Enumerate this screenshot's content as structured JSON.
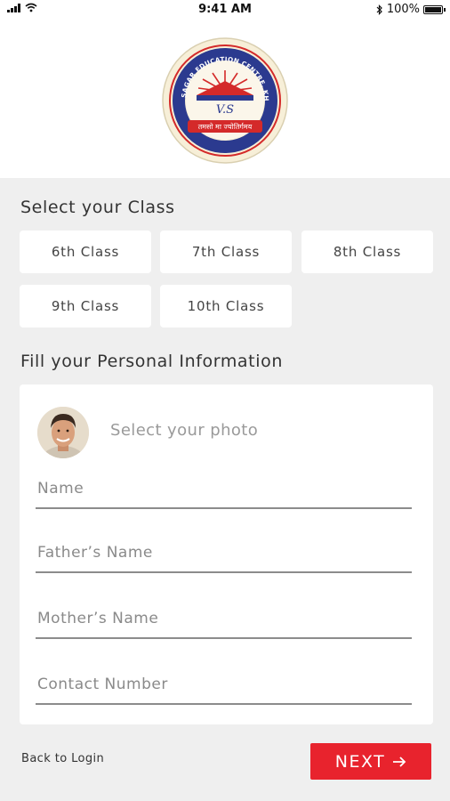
{
  "status_bar": {
    "time": "9:41 AM",
    "battery": "100%",
    "battery_level": 1.0
  },
  "logo": {
    "ring_text": "VIDYA SAGAR EDUCATION CENTRE, KHANDA",
    "monogram": "V.S",
    "motto": "तमसो मा ज्योतिर्गमय",
    "colors": {
      "ring": "#2b3a8f",
      "red": "#d42a2a",
      "cream": "#f7efd8"
    }
  },
  "class_section": {
    "title": "Select your Class",
    "options": [
      "6th Class",
      "7th Class",
      "8th Class",
      "9th Class",
      "10th Class"
    ]
  },
  "personal_section": {
    "title": "Fill your Personal Information",
    "photo_label": "Select your photo",
    "fields": {
      "name_placeholder": "Name",
      "father_placeholder": "Father’s Name",
      "mother_placeholder": "Mother’s Name",
      "contact_placeholder": "Contact Number"
    }
  },
  "footer": {
    "back_label": "Back to Login",
    "next_label": "NEXT",
    "next_icon": "arrow-right-icon",
    "next_color": "#e8232d"
  }
}
